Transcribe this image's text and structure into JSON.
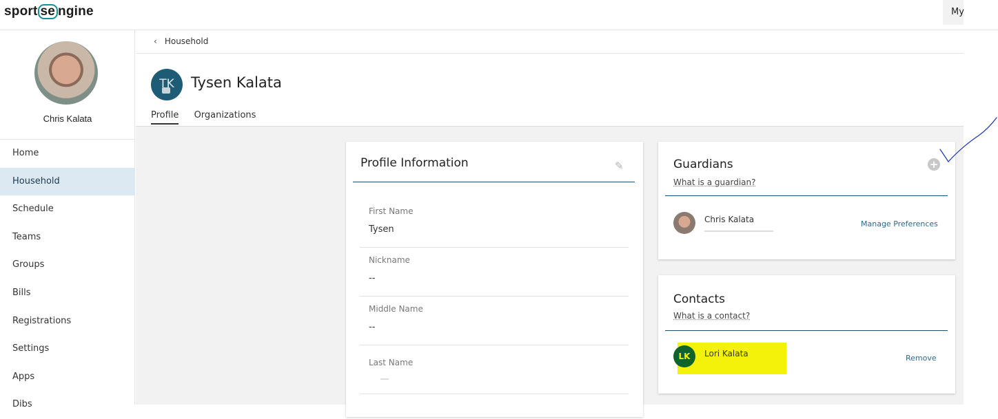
{
  "brand": {
    "name_a": "sport",
    "name_b": "se",
    "name_c": "ngine"
  },
  "topbar": {
    "my_label": "My"
  },
  "user": {
    "name": "Chris Kalata"
  },
  "sidebar": {
    "items": [
      {
        "label": "Home",
        "active": false
      },
      {
        "label": "Household",
        "active": true
      },
      {
        "label": "Schedule",
        "active": false
      },
      {
        "label": "Teams",
        "active": false
      },
      {
        "label": "Groups",
        "active": false
      },
      {
        "label": "Bills",
        "active": false
      },
      {
        "label": "Registrations",
        "active": false
      },
      {
        "label": "Settings",
        "active": false
      },
      {
        "label": "Apps",
        "active": false
      },
      {
        "label": "Dibs",
        "active": false
      }
    ]
  },
  "breadcrumb": {
    "label": "Household"
  },
  "player": {
    "initials": "TK",
    "name": "Tysen Kalata"
  },
  "tabs": [
    {
      "label": "Profile",
      "active": true
    },
    {
      "label": "Organizations",
      "active": false
    }
  ],
  "profile": {
    "title": "Profile Information",
    "fields": [
      {
        "label": "First Name",
        "value": "Tysen"
      },
      {
        "label": "Nickname",
        "value": "--"
      },
      {
        "label": "Middle Name",
        "value": "--"
      },
      {
        "label": "Last Name",
        "value": ""
      }
    ]
  },
  "guardians": {
    "title": "Guardians",
    "help_link": "What is a guardian?",
    "items": [
      {
        "name": "Chris Kalata",
        "action": "Manage Preferences"
      }
    ]
  },
  "contacts": {
    "title": "Contacts",
    "help_link": "What is a contact?",
    "items": [
      {
        "initials": "LK",
        "name": "Lori Kalata",
        "action": "Remove"
      }
    ]
  },
  "colors": {
    "accent": "#1b4d6b",
    "active_nav": "#dde9f2",
    "highlight": "#f4f20a",
    "avatar_tk": "#1e5b74",
    "avatar_lk": "#11632e"
  }
}
